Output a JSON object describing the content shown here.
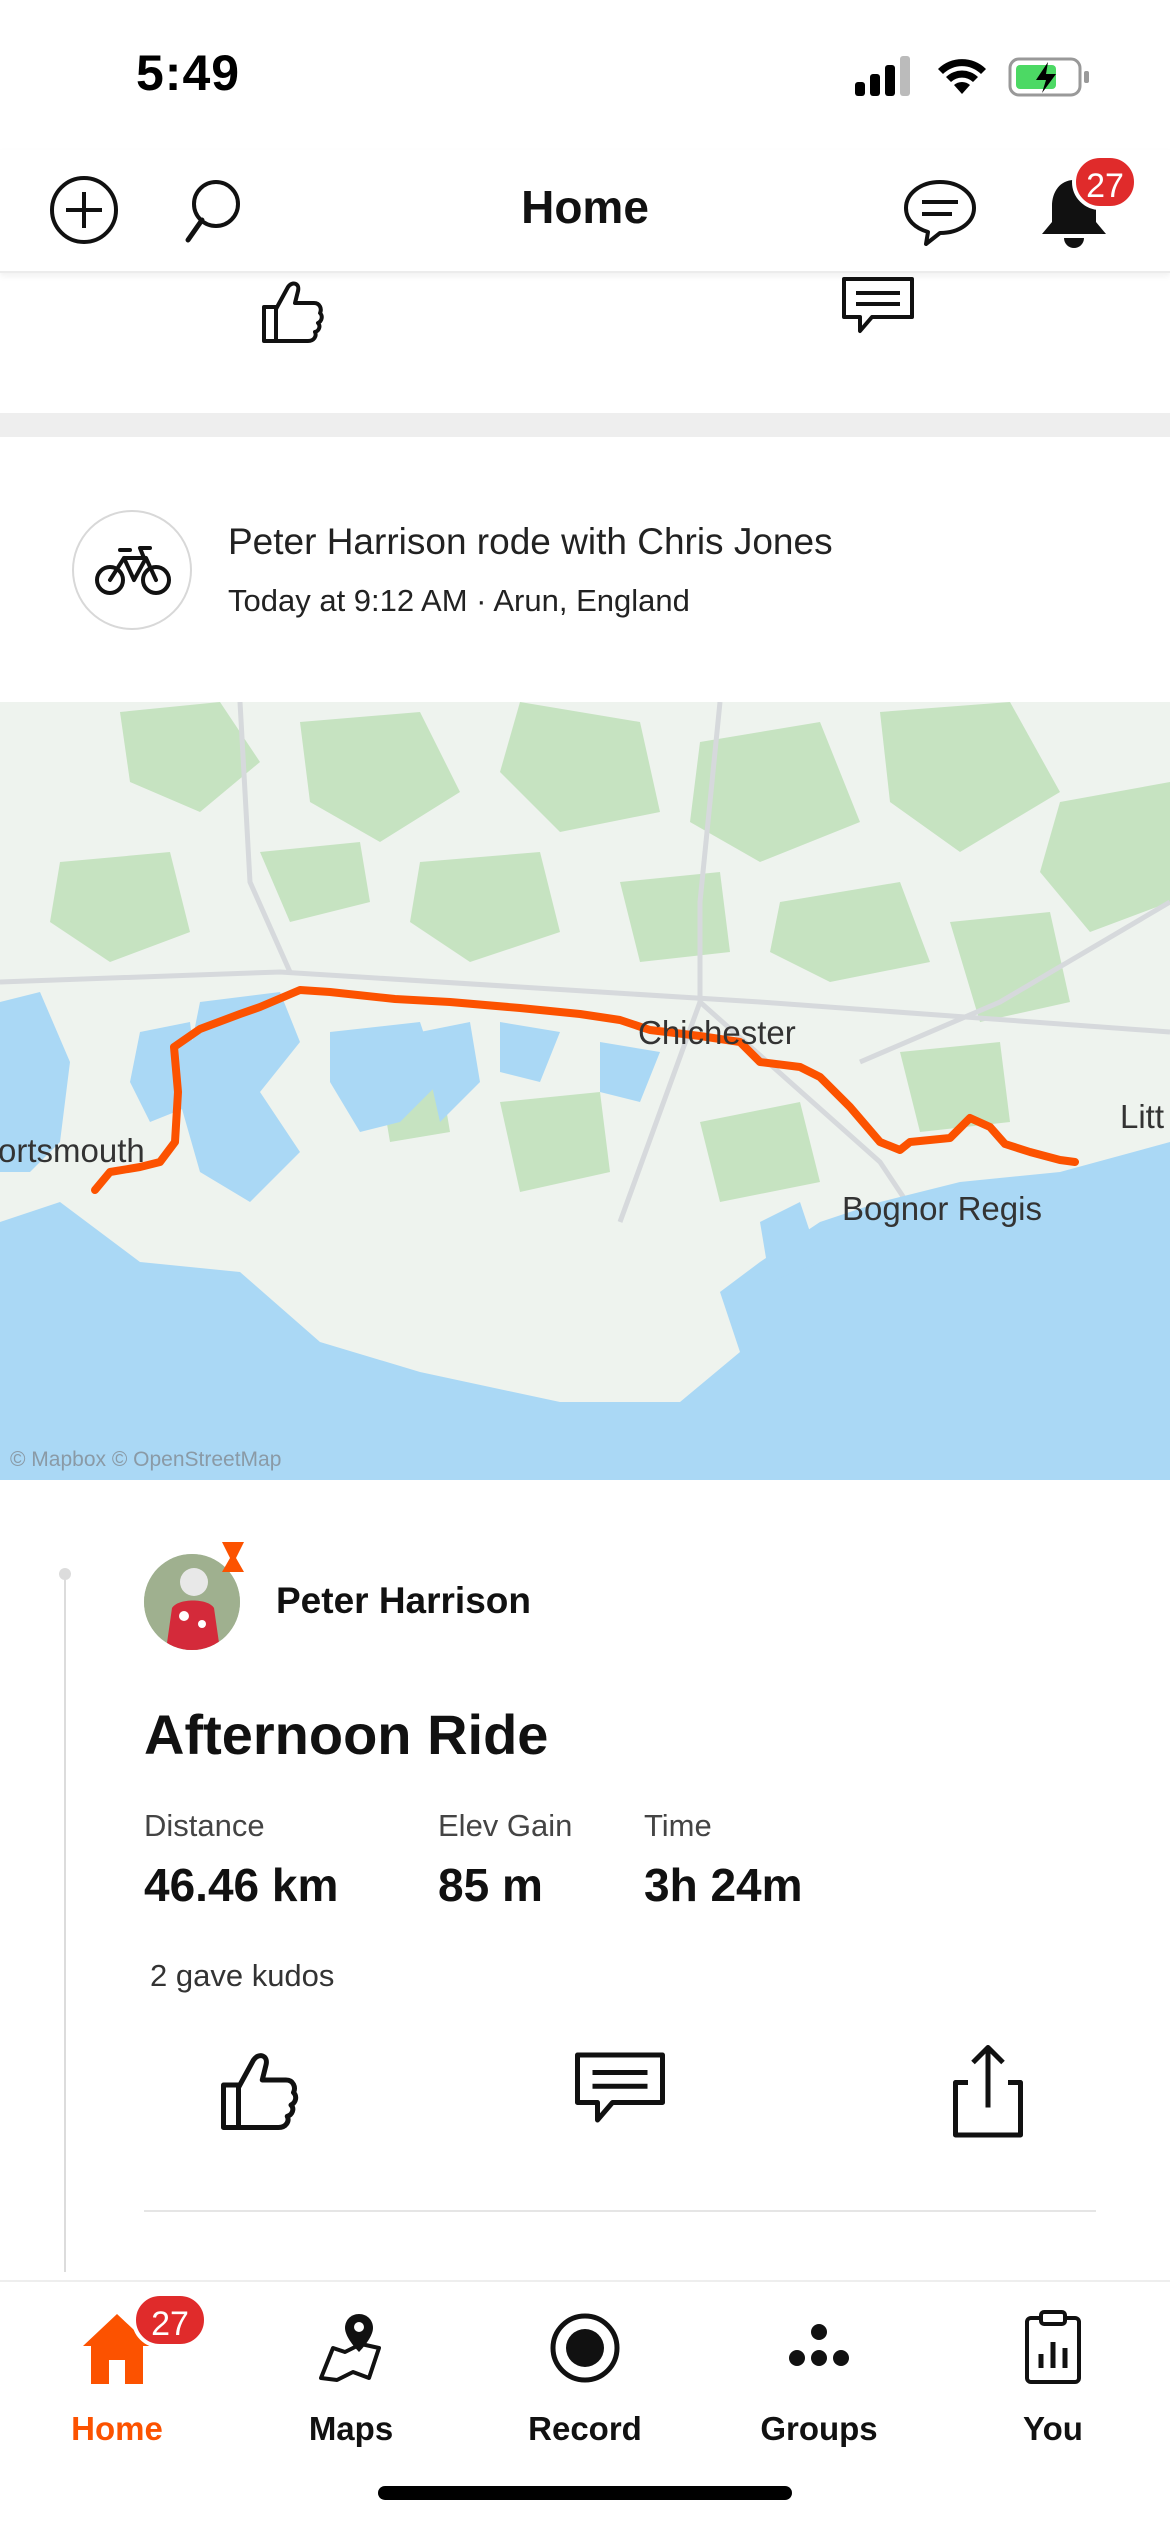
{
  "status_bar": {
    "time": "5:49"
  },
  "header": {
    "title": "Home",
    "notification_count": "27"
  },
  "group_activity": {
    "title": "Peter Harrison rode with Chris Jones",
    "subtitle": "Today at 9:12 AM · Arun, England"
  },
  "map": {
    "labels": {
      "portsmouth": "ortsmouth",
      "chichester": "Chichester",
      "bognor": "Bognor Regis",
      "littlehampton": "Litt"
    },
    "attribution": "© Mapbox © OpenStreetMap",
    "route_color": "#fc5200"
  },
  "activity": {
    "athlete": "Peter Harrison",
    "title": "Afternoon Ride",
    "stats": [
      {
        "label": "Distance",
        "value": "46.46 km"
      },
      {
        "label": "Elev Gain",
        "value": "85 m"
      },
      {
        "label": "Time",
        "value": "3h 24m"
      }
    ],
    "kudos_text": "2 gave kudos"
  },
  "tabs": [
    {
      "label": "Home",
      "icon": "home-icon",
      "active": true,
      "badge": "27"
    },
    {
      "label": "Maps",
      "icon": "maps-icon",
      "active": false
    },
    {
      "label": "Record",
      "icon": "record-icon",
      "active": false
    },
    {
      "label": "Groups",
      "icon": "groups-icon",
      "active": false
    },
    {
      "label": "You",
      "icon": "you-icon",
      "active": false
    }
  ],
  "colors": {
    "brand": "#fc5200",
    "badge": "#e02b2b",
    "water": "#aad8f5",
    "land": "#eaf1ec"
  }
}
